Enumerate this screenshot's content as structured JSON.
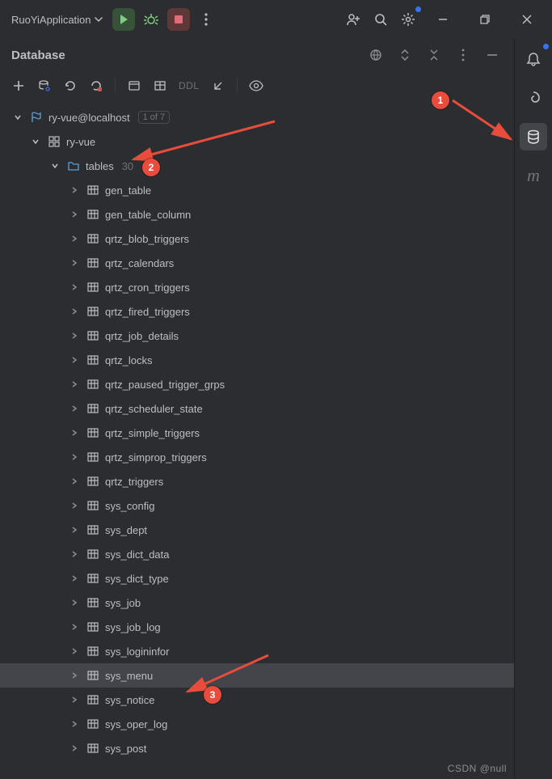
{
  "topbar": {
    "run_config": "RuoYiApplication"
  },
  "panel": {
    "title": "Database",
    "ddl_label": "DDL"
  },
  "tree": {
    "datasource": {
      "label": "ry-vue@localhost",
      "badge": "1 of 7"
    },
    "schema": {
      "label": "ry-vue"
    },
    "tables_node": {
      "label": "tables",
      "count": "30"
    },
    "tables": [
      "gen_table",
      "gen_table_column",
      "qrtz_blob_triggers",
      "qrtz_calendars",
      "qrtz_cron_triggers",
      "qrtz_fired_triggers",
      "qrtz_job_details",
      "qrtz_locks",
      "qrtz_paused_trigger_grps",
      "qrtz_scheduler_state",
      "qrtz_simple_triggers",
      "qrtz_simprop_triggers",
      "qrtz_triggers",
      "sys_config",
      "sys_dept",
      "sys_dict_data",
      "sys_dict_type",
      "sys_job",
      "sys_job_log",
      "sys_logininfor",
      "sys_menu",
      "sys_notice",
      "sys_oper_log",
      "sys_post"
    ],
    "selected_table": "sys_menu"
  },
  "markers": {
    "m1": "1",
    "m2": "2",
    "m3": "3"
  },
  "watermark": "CSDN @null"
}
